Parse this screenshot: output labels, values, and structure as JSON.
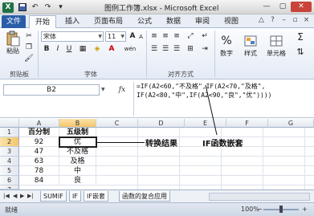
{
  "window": {
    "title": "图例工作簿.xlsx - Microsoft Excel",
    "logo": "X",
    "controls": [
      "minimize-icon",
      "maximize-icon",
      "close-icon"
    ]
  },
  "quick_access": [
    "save-icon",
    "undo-icon",
    "redo-icon",
    "customize-icon"
  ],
  "ribbon_tabs": [
    "文件",
    "开始",
    "插入",
    "页面布局",
    "公式",
    "数据",
    "审阅",
    "视图"
  ],
  "ribbon": {
    "paste_label": "粘贴",
    "font_name": "宋体",
    "font_size": "11",
    "bold": "B",
    "italic": "I",
    "underline": "U",
    "grow_font": "A",
    "shrink_font": "A",
    "wen": "wén",
    "number_label": "数字",
    "style_label": "样式",
    "cells_label": "单元格",
    "sum_symbol": "Σ",
    "sort_symbol": "⇅",
    "groups": {
      "clipboard": "剪贴板",
      "font": "字体",
      "alignment": "对齐方式"
    }
  },
  "formula_bar": {
    "name_box": "B2",
    "fx": "fx",
    "formula": "=IF(A2<60,\"不及格\",IF(A2<70,\"及格\",\nIF(A2<80,\"中\",IF(A2<90,\"良\",\"优\"))))"
  },
  "grid": {
    "columns": [
      "A",
      "B",
      "C",
      "D",
      "E",
      "F",
      "G"
    ],
    "rows": [
      "1",
      "2",
      "3",
      "4",
      "5",
      "6",
      "7"
    ],
    "data": [
      [
        "百分制",
        "五级制"
      ],
      [
        "92",
        "优"
      ],
      [
        "47",
        "不及格"
      ],
      [
        "63",
        "及格"
      ],
      [
        "78",
        "中"
      ],
      [
        "84",
        "良"
      ],
      [
        "",
        ""
      ]
    ],
    "active_cell": "B2"
  },
  "annotations": {
    "result": "转换结果",
    "nested": "IF函数嵌套"
  },
  "sheets": {
    "tabs": [
      "SUMIF",
      "IF",
      "IF嵌套",
      "函数的复合应用"
    ],
    "active": "IF嵌套"
  },
  "status": {
    "text": "就绪",
    "zoom": "100%"
  }
}
